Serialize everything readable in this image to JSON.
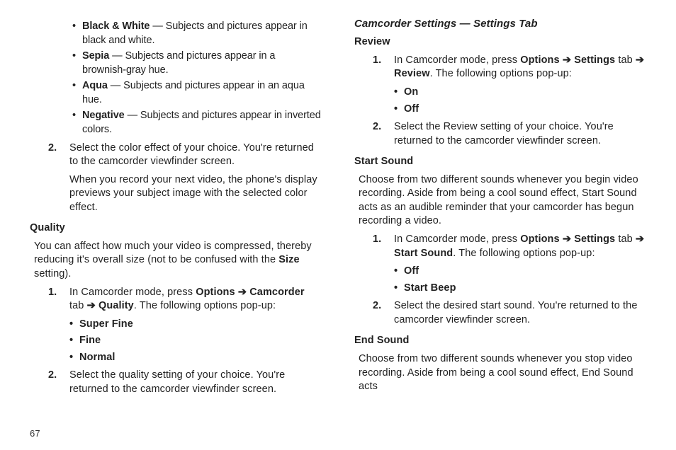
{
  "page_number": "67",
  "left": {
    "effects": [
      {
        "name": "Black & White",
        "desc": " — Subjects and pictures appear in black and white."
      },
      {
        "name": "Sepia",
        "desc": " — Subjects and pictures appear in a brownish-gray hue."
      },
      {
        "name": "Aqua",
        "desc": " — Subjects and pictures appear in an aqua hue."
      },
      {
        "name": "Negative",
        "desc": " — Subjects and pictures appear in inverted colors."
      }
    ],
    "step2a": "Select the color effect of your choice. You're returned to the camcorder viewfinder screen.",
    "step2b": "When you record your next video, the phone's display previews your subject image with the selected color effect.",
    "quality_heading": "Quality",
    "quality_intro_pre": "You can affect how much your video is compressed, thereby reducing it's overall size (not to be confused with the ",
    "quality_intro_bold": "Size",
    "quality_intro_post": " setting).",
    "quality_step1_pre": "In Camcorder mode, press ",
    "options": "Options",
    "arrow": "➔",
    "camcorder_tab": "Camcorder",
    "tab_word": " tab ",
    "quality_word": "Quality",
    "quality_step1_post": ". The following options pop-up:",
    "quality_opts": [
      "Super Fine",
      "Fine",
      "Normal"
    ],
    "quality_step2": "Select the quality setting of your choice. You're returned to the camcorder viewfinder screen."
  },
  "right": {
    "section_heading": "Camcorder Settings — Settings Tab",
    "review_heading": "Review",
    "review_step1_pre": "In Camcorder mode, press ",
    "options": "Options",
    "arrow": "➔",
    "settings_tab": "Settings",
    "tab_word": " tab ",
    "review_word": "Review",
    "review_step1_post": ". The following options pop-up:",
    "review_opts": [
      "On",
      "Off"
    ],
    "review_step2": "Select the Review setting of your choice. You're returned to the camcorder viewfinder screen.",
    "ss_heading": "Start Sound",
    "ss_intro": "Choose from two different sounds whenever you begin video recording. Aside from being a cool sound effect, Start Sound acts as an audible reminder that your camcorder has begun recording a video.",
    "ss_step1_pre": "In Camcorder mode, press ",
    "ss_word": "Start Sound",
    "ss_step1_post": ". The following options pop-up:",
    "ss_opts": [
      "Off",
      "Start Beep"
    ],
    "ss_step2": "Select the desired start sound. You're returned to the camcorder viewfinder screen.",
    "es_heading": "End Sound",
    "es_intro": "Choose from two different sounds whenever you stop video recording. Aside from being a cool sound effect, End Sound acts"
  }
}
